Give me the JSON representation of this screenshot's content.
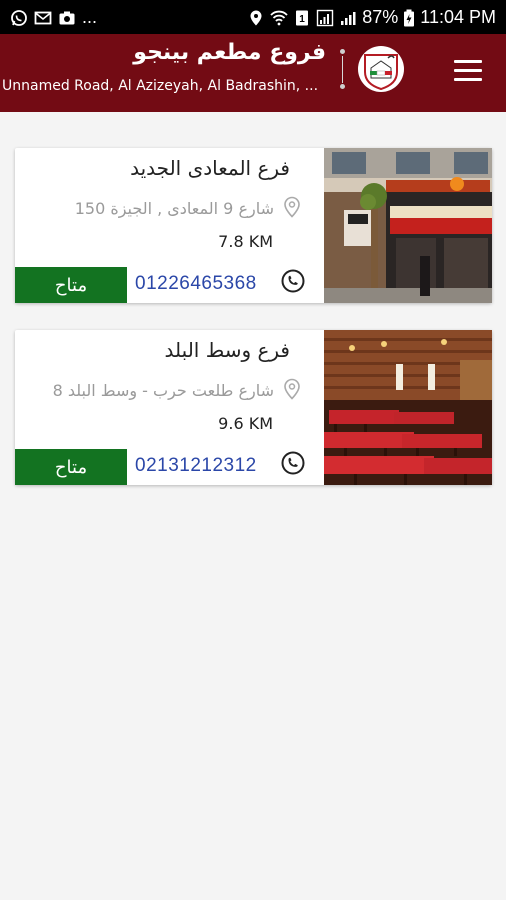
{
  "status_bar": {
    "dots": "...",
    "battery": "87%",
    "time": "11:04 PM"
  },
  "app_bar": {
    "title": "فروع مطعم بينجو",
    "subtitle": "Unnamed Road, Al Azizeyah, Al Badrashin, ...",
    "brand_color": "#730b14"
  },
  "branches": [
    {
      "name": "فرع المعادى الجديد",
      "address": "150 شارع 9 المعادى , الجيزة",
      "distance": "7.8 KM",
      "phone": "01226465368",
      "status": "متاح",
      "photo": "restaurant-storefront"
    },
    {
      "name": "فرع وسط البلد",
      "address": "8 شارع طلعت حرب - وسط البلد",
      "distance": "9.6 KM",
      "phone": "02131212312",
      "status": "متاح",
      "photo": "restaurant-interior"
    }
  ],
  "colors": {
    "available": "#137321",
    "phone_link": "#2b47a8"
  }
}
